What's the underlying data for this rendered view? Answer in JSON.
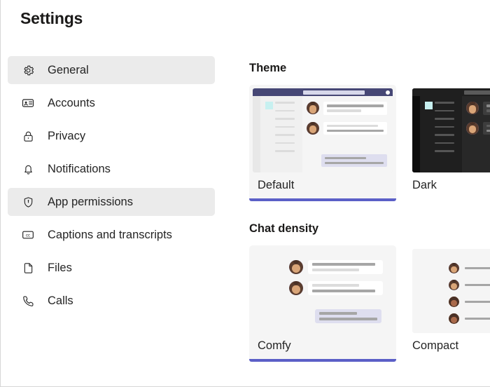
{
  "page": {
    "title": "Settings",
    "accent_color": "#5b5fc7",
    "selected_row_bg": "#ebebeb"
  },
  "sidebar": {
    "items": [
      {
        "label": "General",
        "icon": "gear-icon",
        "selected": true
      },
      {
        "label": "Accounts",
        "icon": "id-card-icon",
        "selected": false
      },
      {
        "label": "Privacy",
        "icon": "lock-icon",
        "selected": false
      },
      {
        "label": "Notifications",
        "icon": "bell-icon",
        "selected": false
      },
      {
        "label": "App permissions",
        "icon": "shield-icon",
        "selected": true
      },
      {
        "label": "Captions and transcripts",
        "icon": "closed-caption-icon",
        "selected": false
      },
      {
        "label": "Files",
        "icon": "file-icon",
        "selected": false
      },
      {
        "label": "Calls",
        "icon": "phone-icon",
        "selected": false
      }
    ]
  },
  "main": {
    "theme": {
      "heading": "Theme",
      "options": [
        {
          "label": "Default",
          "selected": true
        },
        {
          "label": "Dark",
          "selected": false
        }
      ]
    },
    "chat_density": {
      "heading": "Chat density",
      "options": [
        {
          "label": "Comfy",
          "selected": true
        },
        {
          "label": "Compact",
          "selected": false
        }
      ]
    }
  }
}
